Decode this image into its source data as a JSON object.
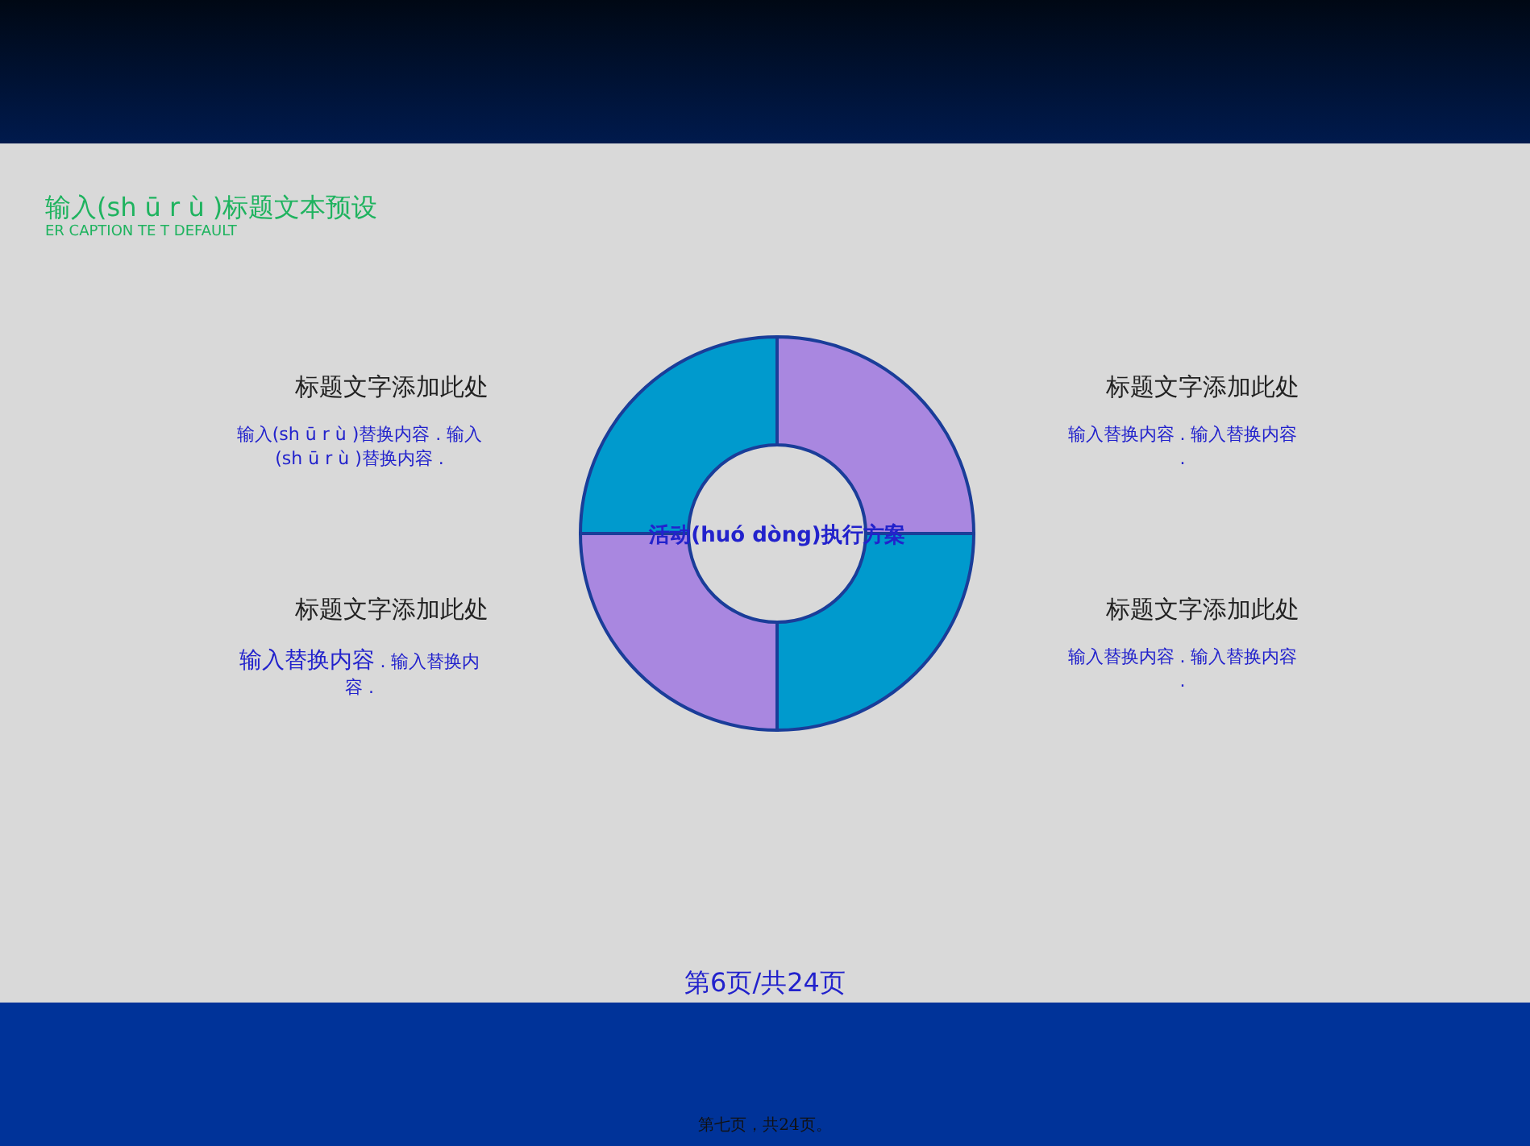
{
  "slide": {
    "title": "输入(sh ū r ù )标题文本预设",
    "subtitle": "ER CAPTION TE T DEFAULT"
  },
  "left_blocks": [
    {
      "heading": "标题文字添加此处",
      "body": "输入(sh ū r ù )替换内容 . 输入(sh ū r ù )替换内容 ."
    },
    {
      "heading": "标题文字添加此处",
      "body_lead": "输入替换内容",
      "body": " . 输入替换内容 ."
    }
  ],
  "right_blocks": [
    {
      "heading": "标题文字添加此处",
      "body": "输入替换内容 . 输入替换内容 ."
    },
    {
      "heading": "标题文字添加此处",
      "body": "输入替换内容 . 输入替换内容 ."
    }
  ],
  "diagram": {
    "center_label": "活动(huó dòng)执行方案",
    "segments": [
      {
        "color": "#a987e0"
      },
      {
        "color": "#009acd"
      },
      {
        "color": "#a987e0"
      },
      {
        "color": "#009acd"
      }
    ]
  },
  "page_number": "第6页/共24页",
  "footer_note": "第七页，共24页。"
}
